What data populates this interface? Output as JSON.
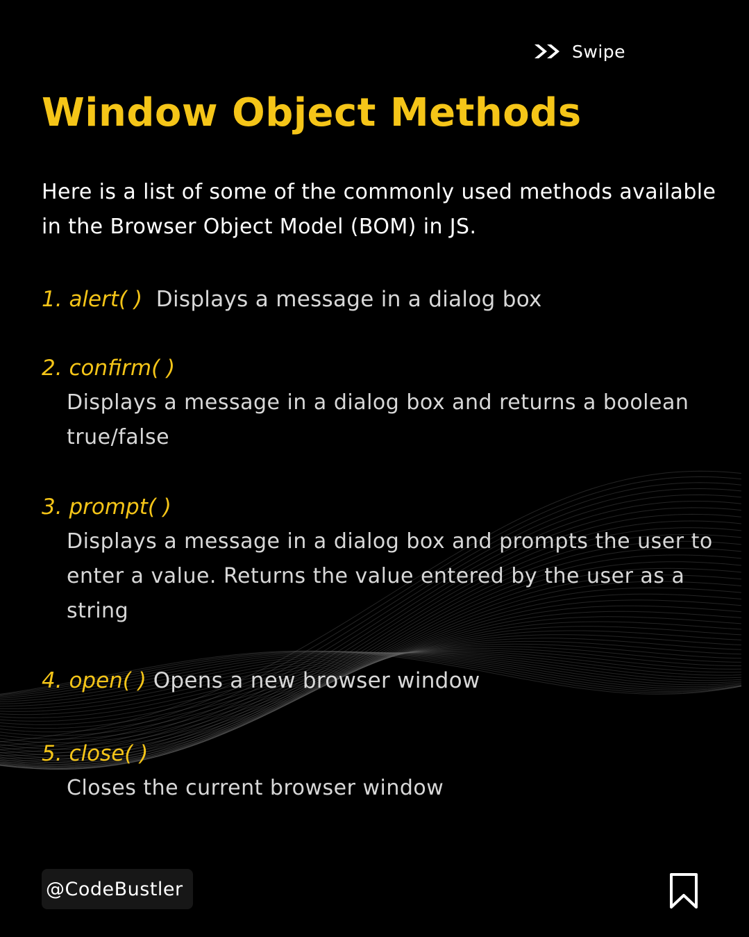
{
  "header": {
    "swipe_label": "Swipe",
    "swipe_icon": "double-chevron-right-icon",
    "title": "Window Object Methods"
  },
  "intro": "Here is a list of some of the commonly used methods available in the Browser Object Model (BOM) in JS.",
  "methods": [
    {
      "number": "1.",
      "name": "alert( )",
      "description": "Displays a message in a dialog box"
    },
    {
      "number": "2.",
      "name": "confirm( )",
      "description": "Displays a message in a dialog box and returns a boolean true/false"
    },
    {
      "number": "3.",
      "name": "prompt( )",
      "description": "Displays a message in a dialog box and prompts the user to enter a value. Returns the value entered by the user as a string"
    },
    {
      "number": "4.",
      "name": "open( )",
      "description": "Opens a new browser window"
    },
    {
      "number": "5.",
      "name": "close( )",
      "description": "Closes the current browser window"
    }
  ],
  "footer": {
    "handle": "@CodeBustler",
    "bookmark_icon": "bookmark-icon"
  },
  "colors": {
    "background": "#000000",
    "accent": "#f5c518",
    "text": "#ffffff",
    "muted_text": "#d8d8d8",
    "handle_bg": "#171717"
  }
}
